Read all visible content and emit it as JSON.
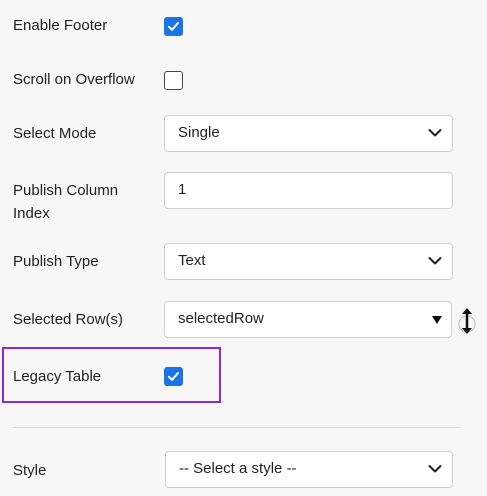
{
  "fields": {
    "enable_footer": {
      "label": "Enable Footer",
      "checked": true
    },
    "scroll_overflow": {
      "label": "Scroll on Overflow",
      "checked": false
    },
    "select_mode": {
      "label": "Select Mode",
      "value": "Single"
    },
    "publish_column_index": {
      "label_line1": "Publish Column",
      "label_line2": "Index",
      "value": "1"
    },
    "publish_type": {
      "label": "Publish Type",
      "value": "Text"
    },
    "selected_rows": {
      "label": "Selected Row(s)",
      "value": "selectedRow"
    },
    "legacy_table": {
      "label": "Legacy Table",
      "checked": true
    },
    "style": {
      "label": "Style",
      "placeholder": "-- Select a style --"
    }
  },
  "colors": {
    "checkbox_checked": "#1a73e8",
    "highlight_border": "#8a2be2",
    "input_border": "#cfcfcf"
  },
  "icons": {
    "check": "check-icon",
    "chevron": "chevron-down-icon",
    "dropdown_triangle": "triangle-down-icon",
    "resize": "resize-vertical-icon"
  }
}
